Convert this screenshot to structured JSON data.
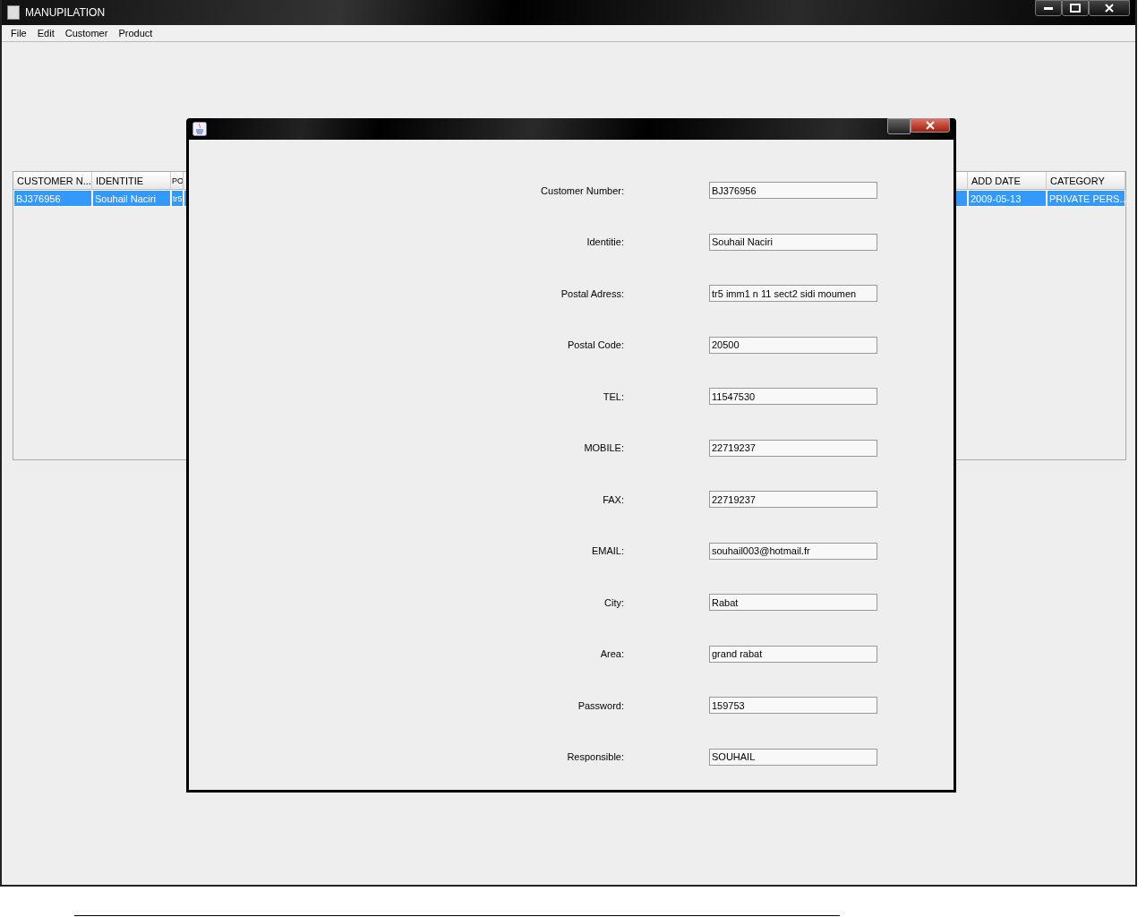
{
  "window": {
    "title": "MANUPILATION"
  },
  "menu": [
    "File",
    "Edit",
    "Customer",
    "Product"
  ],
  "table": {
    "columns": [
      "CUSTOMER N...",
      "IDENTITIE",
      "PO",
      "",
      "ADD DATE",
      "CATEGORY"
    ],
    "rows": [
      {
        "selected": true,
        "cells": [
          "BJ376956",
          "Souhail Naciri",
          "tr5",
          "",
          "2009-05-13",
          "PRIVATE PERS..."
        ]
      }
    ]
  },
  "dialog": {
    "fields": [
      {
        "label": "Customer Number:",
        "value": "BJ376956"
      },
      {
        "label": "Identitie:",
        "value": "Souhail Naciri"
      },
      {
        "label": "Postal Adress:",
        "value": "tr5 imm1 n 11 sect2 sidi moumen"
      },
      {
        "label": "Postal Code:",
        "value": "20500"
      },
      {
        "label": "TEL:",
        "value": "11547530"
      },
      {
        "label": "MOBILE:",
        "value": "22719237"
      },
      {
        "label": "FAX:",
        "value": "22719237"
      },
      {
        "label": "EMAIL:",
        "value": "souhail003@hotmail.fr"
      },
      {
        "label": "City:",
        "value": "Rabat"
      },
      {
        "label": "Area:",
        "value": "grand rabat"
      },
      {
        "label": "Password:",
        "value": "159753"
      },
      {
        "label": "Responsible:",
        "value": "SOUHAIL"
      }
    ]
  }
}
